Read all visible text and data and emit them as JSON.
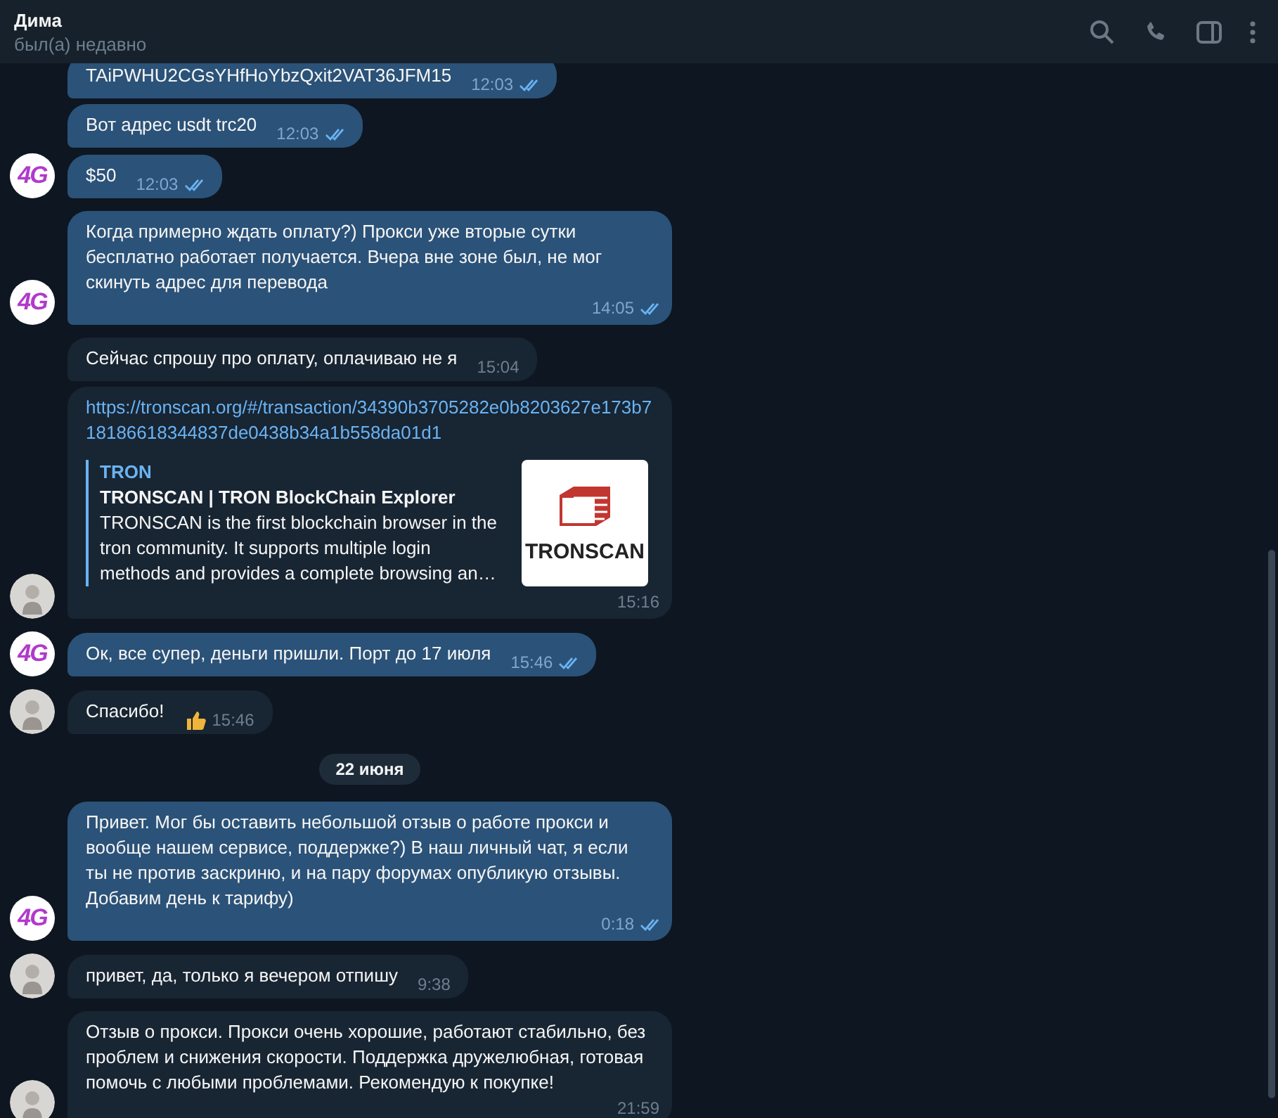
{
  "header": {
    "name": "Дима",
    "status": "был(а) недавно"
  },
  "messages": [
    {
      "kind": "text",
      "outgoing": true,
      "text": "TAiPWHU2CGsYHfHoYbzQxit2VAT36JFM15",
      "time": "12:03",
      "read": true
    },
    {
      "kind": "text",
      "outgoing": true,
      "text": "Вот адрес usdt trc20",
      "time": "12:03",
      "read": true
    },
    {
      "kind": "text",
      "outgoing": true,
      "text": "$50",
      "time": "12:03",
      "read": true,
      "avatar": {
        "kind": "logo",
        "text": "4G"
      }
    },
    {
      "kind": "text",
      "outgoing": true,
      "text": "Когда примерно ждать оплату?) Прокси уже вторые сутки бесплатно работает получается. Вчера вне зоне был, не мог скинуть адрес для перевода",
      "time": "14:05",
      "read": true,
      "avatar": {
        "kind": "logo",
        "text": "4G"
      }
    },
    {
      "kind": "text",
      "outgoing": false,
      "text": "Сейчас спрошу про оплату, оплачиваю не я",
      "time": "15:04"
    },
    {
      "kind": "link",
      "outgoing": false,
      "text": "https://tronscan.org/#/transaction/34390b3705282e0b8203627e173b718186618344837de0438b34a1b558da01d1",
      "preview": {
        "site": "TRON",
        "title": "TRONSCAN | TRON BlockChain Explorer",
        "description": "TRONSCAN is the first blockchain browser in the tron community. It supports multiple login methods and provides a complete browsing an…",
        "logo_text": "TRONSCAN"
      },
      "time": "15:16"
    },
    {
      "kind": "text",
      "outgoing": true,
      "text": "Ок, все супер, деньги пришли. Порт до 17 июля",
      "time": "15:46",
      "read": true,
      "avatar": {
        "kind": "logo",
        "text": "4G"
      }
    },
    {
      "kind": "text",
      "outgoing": false,
      "text": "Спасибо!",
      "time": "15:46",
      "reacted": true
    },
    {
      "kind": "date",
      "text": "22 июня"
    },
    {
      "kind": "text",
      "outgoing": true,
      "text": "Привет. Мог бы оставить небольшой отзыв о работе прокси и вообще нашем сервисе, поддержке?) В наш личный чат, я если ты не против заскриню, и на пару форумах опубликую отзывы. Добавим день к тарифу)",
      "time": "0:18",
      "read": true,
      "avatar": {
        "kind": "logo",
        "text": "4G"
      }
    },
    {
      "kind": "text",
      "outgoing": false,
      "text": "привет, да, только я вечером отпишу",
      "time": "9:38"
    },
    {
      "kind": "text",
      "outgoing": false,
      "text": "Отзыв о прокси. Прокси очень хорошие, работают стабильно, без проблем и снижения скорости. Поддержка дружелюбная, готовая помочь с любыми проблемами. Рекомендую к покупке!",
      "time": "21:59"
    }
  ]
}
